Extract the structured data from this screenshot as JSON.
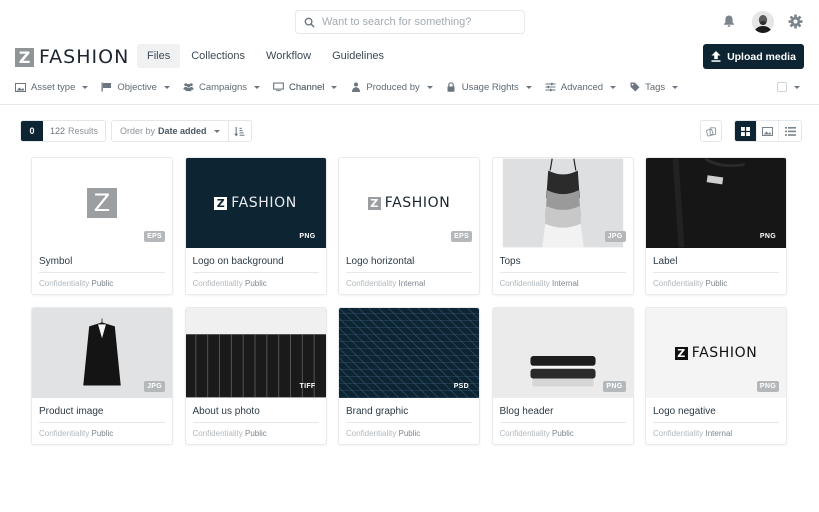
{
  "search": {
    "placeholder": "Want to search for something?"
  },
  "header": {
    "logo_mark": "Z",
    "logo_text": "FASHION",
    "nav": [
      {
        "label": "Files",
        "active": true
      },
      {
        "label": "Collections",
        "active": false
      },
      {
        "label": "Workflow",
        "active": false
      },
      {
        "label": "Guidelines",
        "active": false
      }
    ],
    "upload_label": "Upload media",
    "icons": {
      "notifications": "bell-icon",
      "profile": "avatar",
      "settings": "gear-icon"
    }
  },
  "filters": [
    {
      "label": "Asset type",
      "icon": "image-icon"
    },
    {
      "label": "Objective",
      "icon": "flag-icon"
    },
    {
      "label": "Campaigns",
      "icon": "users-icon"
    },
    {
      "label": "Channel",
      "icon": "monitor-icon"
    },
    {
      "label": "Produced by",
      "icon": "user-icon"
    },
    {
      "label": "Usage Rights",
      "icon": "lock-icon"
    },
    {
      "label": "Advanced",
      "icon": "sliders-icon"
    },
    {
      "label": "Tags",
      "icon": "tag-icon"
    }
  ],
  "toolbar": {
    "selected_count": "0",
    "results_count": "122",
    "results_label": "Results",
    "order_prefix": "Order by",
    "order_value": "Date added"
  },
  "colors": {
    "brand_dark": "#0d2433",
    "logo_grey": "#8f9497"
  },
  "assets": [
    {
      "title": "Symbol",
      "format": "EPS",
      "confidentiality_label": "Confidentiality",
      "confidentiality": "Public"
    },
    {
      "title": "Logo on background",
      "format": "PNG",
      "confidentiality_label": "Confidentiality",
      "confidentiality": "Public"
    },
    {
      "title": "Logo horizontal",
      "format": "EPS",
      "confidentiality_label": "Confidentiality",
      "confidentiality": "Internal"
    },
    {
      "title": "Tops",
      "format": "JPG",
      "confidentiality_label": "Confidentiality",
      "confidentiality": "Internal"
    },
    {
      "title": "Label",
      "format": "PNG",
      "confidentiality_label": "Confidentiality",
      "confidentiality": "Public"
    },
    {
      "title": "Product image",
      "format": "JPG",
      "confidentiality_label": "Confidentiality",
      "confidentiality": "Public"
    },
    {
      "title": "About us photo",
      "format": "TIFF",
      "confidentiality_label": "Confidentiality",
      "confidentiality": "Public"
    },
    {
      "title": "Brand graphic",
      "format": "PSD",
      "confidentiality_label": "Confidentiality",
      "confidentiality": "Public"
    },
    {
      "title": "Blog header",
      "format": "PNG",
      "confidentiality_label": "Confidentiality",
      "confidentiality": "Public"
    },
    {
      "title": "Logo negative",
      "format": "PNG",
      "confidentiality_label": "Confidentiality",
      "confidentiality": "Internal"
    }
  ]
}
